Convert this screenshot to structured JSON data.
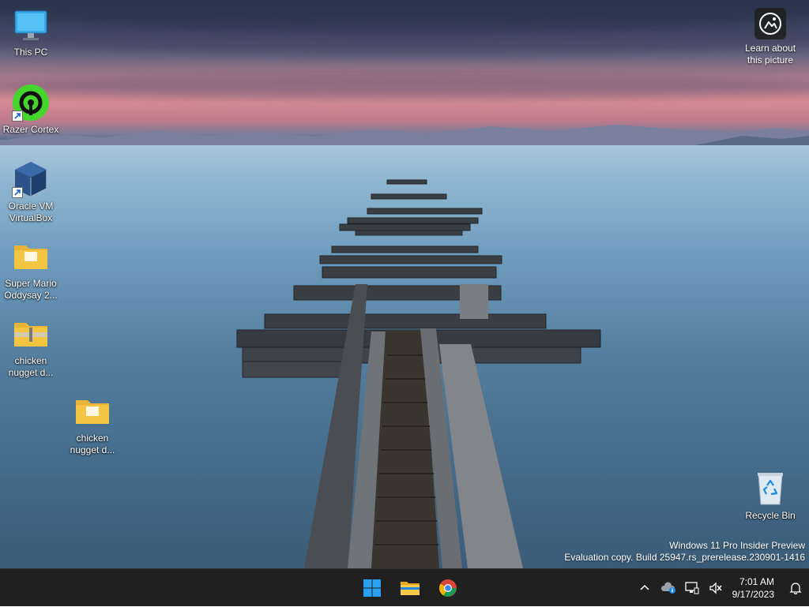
{
  "desktop": {
    "icons": [
      {
        "label": "This PC"
      },
      {
        "label": "Razer Cortex"
      },
      {
        "label": "Oracle VM VirtualBox"
      },
      {
        "label": "Super Mario Oddysay 2..."
      },
      {
        "label": "chicken nugget d..."
      },
      {
        "label": "chicken nugget d..."
      },
      {
        "label": "Recycle Bin"
      }
    ],
    "learn_about": "Learn about this picture"
  },
  "watermark": {
    "line1": "Windows 11 Pro Insider Preview",
    "line2": "Evaluation copy. Build 25947.rs_prerelease.230901-1416"
  },
  "taskbar": {
    "pinned": [
      {
        "icon": "windows-start-icon"
      },
      {
        "icon": "file-explorer-icon"
      },
      {
        "icon": "chrome-icon"
      }
    ],
    "tray": {
      "time": "7:01 AM",
      "date": "9/17/2023"
    }
  },
  "colors": {
    "taskbar_bg": "#202020",
    "folder_yellow": "#f4c542",
    "start_blue": "#2aa0f0",
    "razer_green": "#44d62c"
  }
}
